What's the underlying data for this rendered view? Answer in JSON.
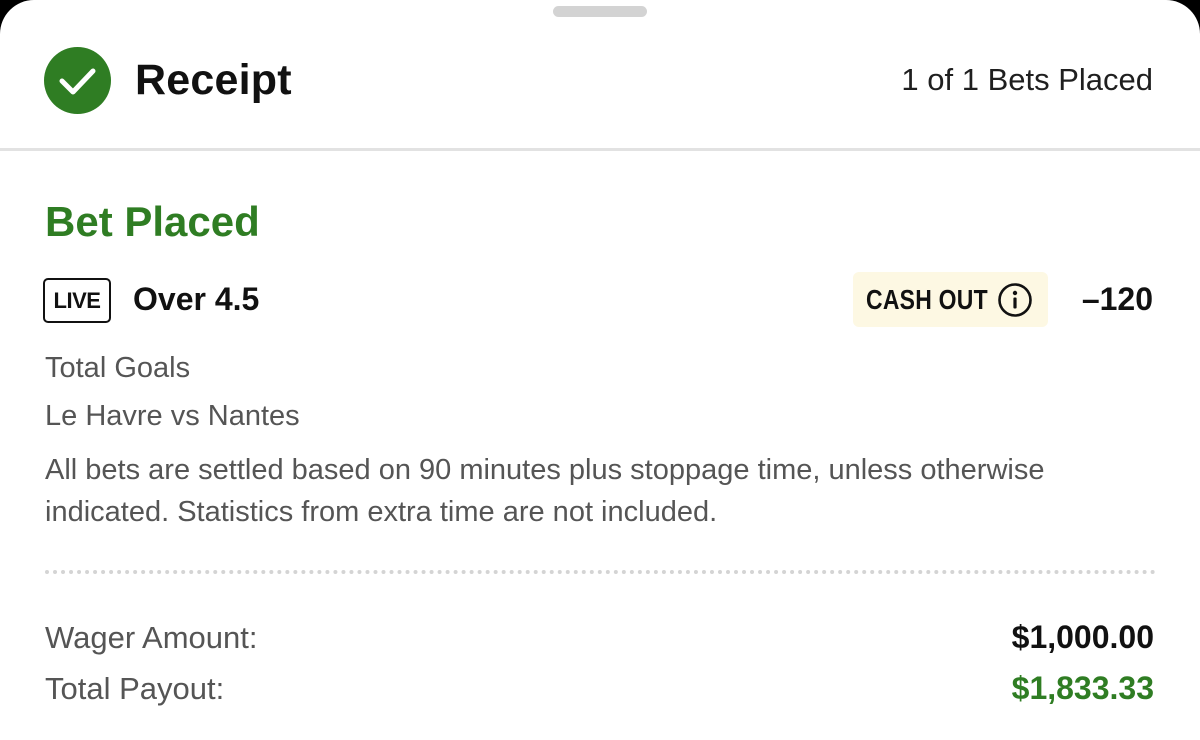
{
  "header": {
    "title": "Receipt",
    "bets_placed": "1 of 1 Bets Placed"
  },
  "bet": {
    "status": "Bet Placed",
    "live_badge": "LIVE",
    "selection": "Over 4.5",
    "cash_out_label": "CASH OUT",
    "odds": "–120",
    "market": "Total Goals",
    "event": "Le Havre vs Nantes",
    "rules": "All bets are settled based on 90 minutes plus stoppage time, unless otherwise indicated. Statistics from extra time are not included."
  },
  "summary": {
    "wager_label": "Wager Amount:",
    "wager_value": "$1,000.00",
    "payout_label": "Total Payout:",
    "payout_value": "$1,833.33"
  },
  "icons": {
    "success": "check-circle-icon",
    "info": "info-icon"
  },
  "colors": {
    "accent_green": "#2f7d23",
    "cash_out_bg": "#fdf8e3",
    "secondary_text": "#555555"
  }
}
